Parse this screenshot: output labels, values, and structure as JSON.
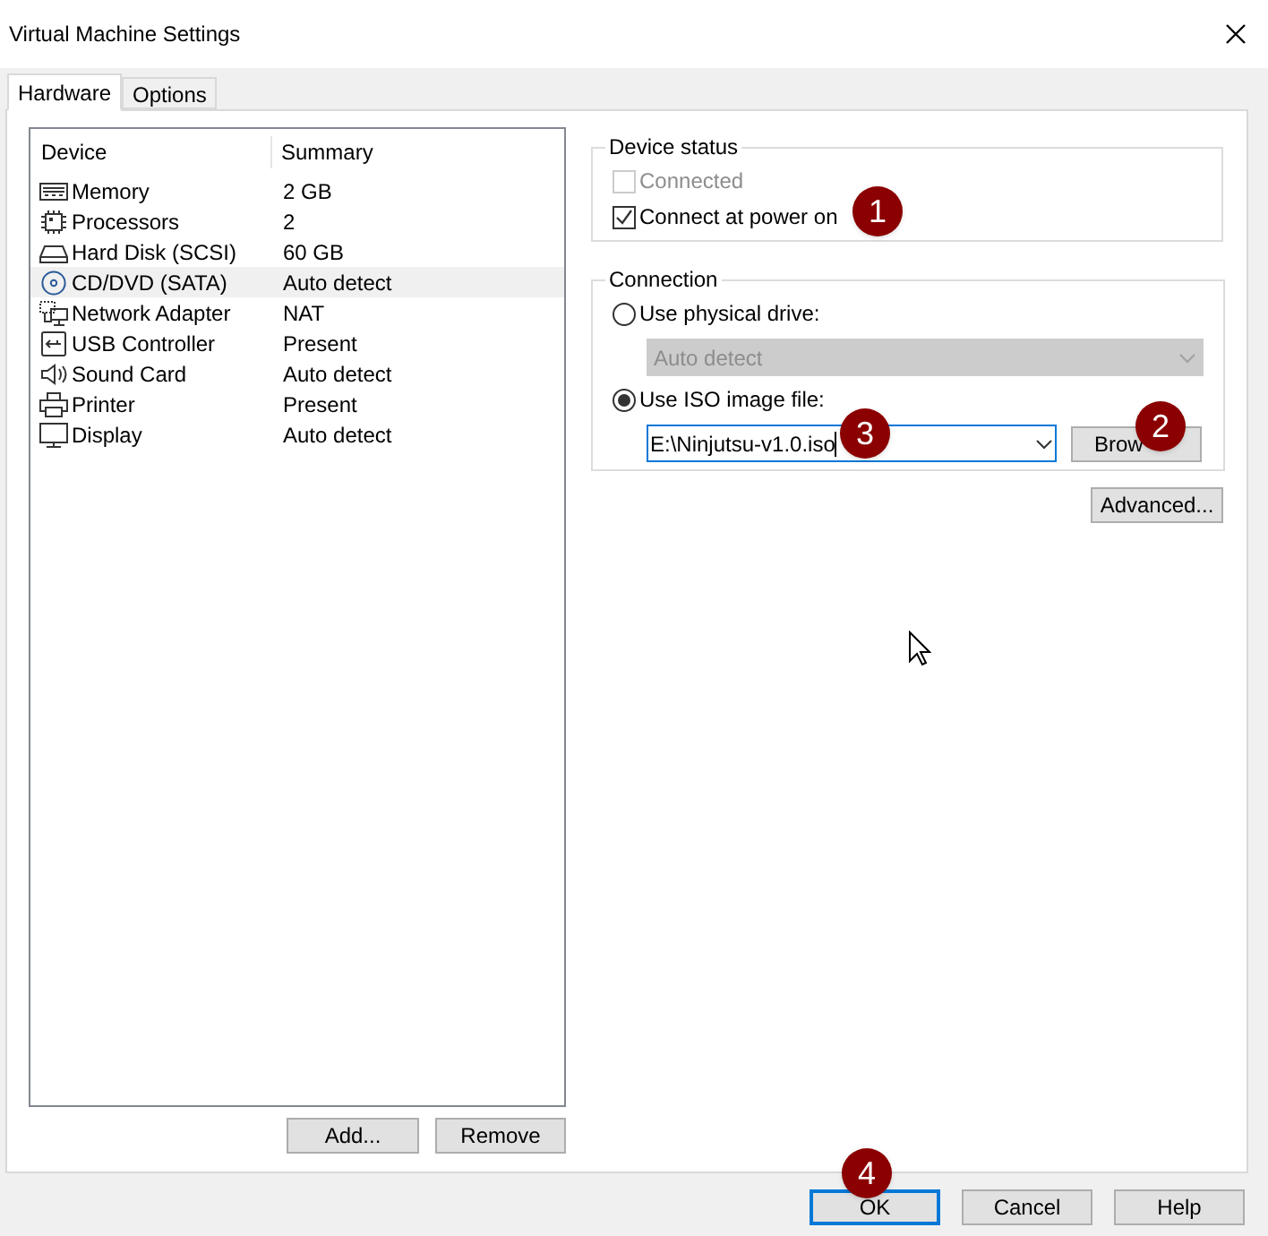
{
  "window": {
    "title": "Virtual Machine Settings"
  },
  "tabs": [
    {
      "label": "Hardware",
      "selected": true
    },
    {
      "label": "Options",
      "selected": false
    }
  ],
  "devices": {
    "columns": [
      "Device",
      "Summary"
    ],
    "rows": [
      {
        "kind": "memory",
        "device": "Memory",
        "summary": "2 GB",
        "selected": false
      },
      {
        "kind": "cpu",
        "device": "Processors",
        "summary": "2",
        "selected": false
      },
      {
        "kind": "disk",
        "device": "Hard Disk (SCSI)",
        "summary": "60 GB",
        "selected": false
      },
      {
        "kind": "cd",
        "device": "CD/DVD (SATA)",
        "summary": "Auto detect",
        "selected": true
      },
      {
        "kind": "network",
        "device": "Network Adapter",
        "summary": "NAT",
        "selected": false
      },
      {
        "kind": "usb",
        "device": "USB Controller",
        "summary": "Present",
        "selected": false
      },
      {
        "kind": "sound",
        "device": "Sound Card",
        "summary": "Auto detect",
        "selected": false
      },
      {
        "kind": "printer",
        "device": "Printer",
        "summary": "Present",
        "selected": false
      },
      {
        "kind": "display",
        "device": "Display",
        "summary": "Auto detect",
        "selected": false
      }
    ]
  },
  "device_buttons": [
    "Add...",
    "Remove"
  ],
  "device_status": {
    "title": "Device status",
    "options": [
      {
        "label": "Connected",
        "checked": false,
        "disabled": true
      },
      {
        "label": "Connect at power on",
        "checked": true,
        "disabled": false
      }
    ]
  },
  "connection": {
    "title": "Connection",
    "physical": {
      "label": "Use physical drive:",
      "selected": false
    },
    "drive_select": {
      "value": "Auto detect",
      "disabled": true
    },
    "iso": {
      "label": "Use ISO image file:",
      "selected": true
    },
    "iso_field": {
      "value": "E:\\Ninjutsu-v1.0.iso"
    },
    "browse_button": "Brow"
  },
  "advanced_button": "Advanced...",
  "footer_buttons": [
    {
      "label": "OK",
      "default": true
    },
    {
      "label": "Cancel",
      "default": false
    },
    {
      "label": "Help",
      "default": false
    }
  ],
  "annotations": [
    "1",
    "3",
    "2",
    "4"
  ]
}
